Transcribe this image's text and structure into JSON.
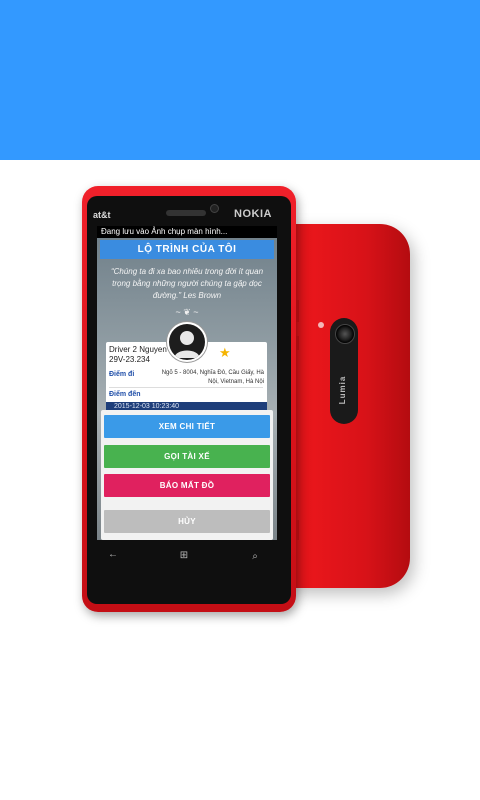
{
  "banner": {
    "color": "#3399ff"
  },
  "phone": {
    "brand": "NOKIA",
    "carrier": "at&t",
    "camera_label": "Lumia"
  },
  "app": {
    "toast": "Đang lưu vào Ảnh chụp màn hình...",
    "title": "LỘ TRÌNH CỦA TÔI",
    "quote": "“Chúng ta đi xa bao nhiêu trong đời ít quan trọng bằng những người chúng ta gặp dọc đường.” Les Brown",
    "flourish": "~ ❦ ~",
    "card": {
      "driver_name": "Driver 2 Nguyen",
      "plate": "29V-23.234",
      "from_label": "Điểm đi",
      "from_address": "Ngõ 5 - 8004, Nghĩa Đô, Cầu Giấy, Hà Nội, Vietnam, Hà Nội",
      "to_label": "Điểm đến",
      "time": "2015-12-03 10:23:40"
    },
    "actions": {
      "view_detail": "XEM CHI TIẾT",
      "call_driver": "GỌI TÀI XẾ",
      "report_lost": "BÁO MẤT ĐỒ",
      "cancel": "HỦY"
    },
    "colors": {
      "title_bar": "#3a8ce0",
      "view": "#3a9ae8",
      "call": "#48b24f",
      "report": "#e0215f",
      "cancel": "#bdbdbd"
    }
  },
  "nav": {
    "back": "←",
    "start": "⊞",
    "search": "⌕"
  }
}
